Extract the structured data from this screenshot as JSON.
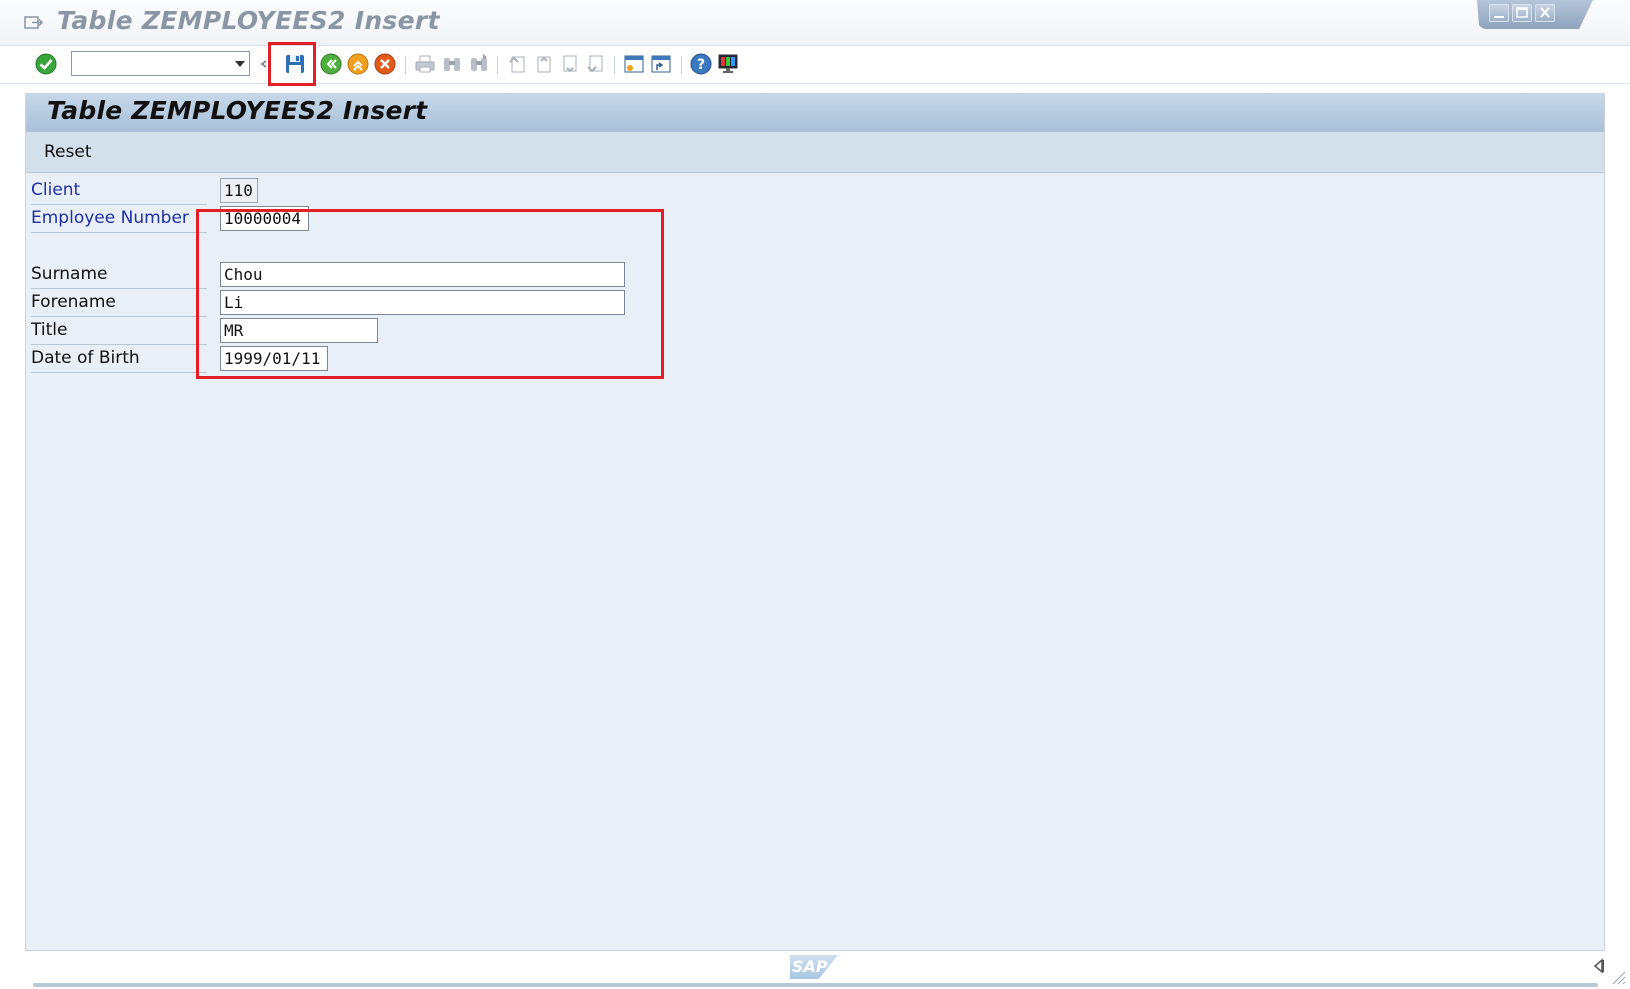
{
  "window": {
    "title": "Table ZEMPLOYEES2 Insert"
  },
  "toolbar": {
    "command_field_value": "",
    "buttons": [
      {
        "name": "enter",
        "icon": "check-circle-icon"
      },
      {
        "name": "save",
        "icon": "save-disk-icon"
      },
      {
        "name": "back",
        "icon": "back-arrow-icon"
      },
      {
        "name": "exit",
        "icon": "exit-icon"
      },
      {
        "name": "cancel",
        "icon": "cancel-icon"
      },
      {
        "name": "print",
        "icon": "print-icon"
      },
      {
        "name": "find",
        "icon": "find-icon"
      },
      {
        "name": "find-next",
        "icon": "find-next-icon"
      },
      {
        "name": "first-page",
        "icon": "first-page-icon"
      },
      {
        "name": "previous-page",
        "icon": "previous-page-icon"
      },
      {
        "name": "next-page",
        "icon": "next-page-icon"
      },
      {
        "name": "last-page",
        "icon": "last-page-icon"
      },
      {
        "name": "create-session",
        "icon": "new-session-icon"
      },
      {
        "name": "create-shortcut",
        "icon": "shortcut-icon"
      },
      {
        "name": "help",
        "icon": "help-icon"
      },
      {
        "name": "customize-layout",
        "icon": "monitor-icon"
      }
    ],
    "highlight_color": "#e01f26"
  },
  "screen": {
    "title": "Table ZEMPLOYEES2 Insert",
    "reset_label": "Reset"
  },
  "form": {
    "client": {
      "label": "Client",
      "value": "110"
    },
    "employee_number": {
      "label": "Employee Number",
      "value": "10000004"
    },
    "surname": {
      "label": "Surname",
      "value": "Chou"
    },
    "forename": {
      "label": "Forename",
      "value": "Li"
    },
    "title": {
      "label": "Title",
      "value": "MR"
    },
    "dob": {
      "label": "Date of Birth",
      "value": "1999/01/11"
    }
  },
  "footer": {
    "logo": "SAP"
  }
}
